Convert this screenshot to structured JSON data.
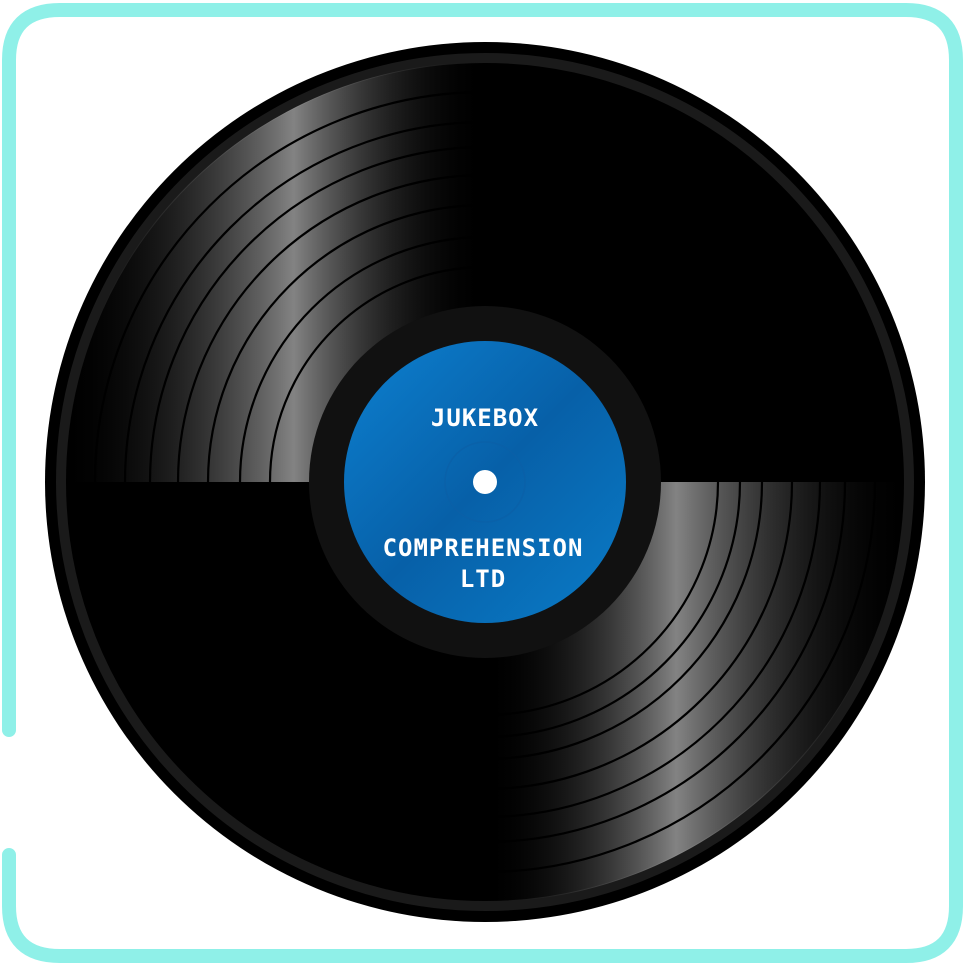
{
  "frame": {
    "color": "#8ff0e8"
  },
  "record": {
    "vinyl_color": "#000000",
    "ring_color": "#111111",
    "groove_color": "#111111",
    "label": {
      "top_text": "JUKEBOX",
      "bottom_text_line1": "COMPREHENSION",
      "bottom_text_line2": "LTD",
      "color": "#0a6fbd",
      "text_color": "#ffffff"
    },
    "spindle_hole_color": "#ffffff"
  }
}
